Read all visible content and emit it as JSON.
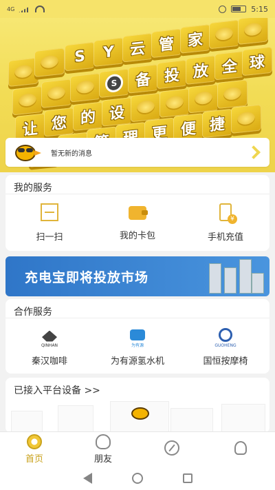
{
  "status": {
    "signal": "4G",
    "time": "5:15"
  },
  "hero": {
    "row1_chars": [
      "S",
      "Y",
      "云",
      "管",
      "家"
    ],
    "row2_chars": [
      "备",
      "投",
      "放",
      "全",
      "球"
    ],
    "row3_chars": [
      "让",
      "您",
      "的",
      "设"
    ],
    "row4_chars": [
      "管",
      "理",
      "更",
      "便",
      "捷"
    ]
  },
  "notice": {
    "text": "暂无新的消息"
  },
  "services": {
    "title": "我的服务",
    "items": [
      {
        "label": "扫一扫",
        "icon": "scan-icon"
      },
      {
        "label": "我的卡包",
        "icon": "wallet-icon"
      },
      {
        "label": "手机充值",
        "icon": "phone-recharge-icon"
      }
    ]
  },
  "banner": {
    "text": "充电宝即将投放市场"
  },
  "partners": {
    "title": "合作服务",
    "items": [
      {
        "label": "秦汉咖啡",
        "logo_text": "QINHAN"
      },
      {
        "label": "为有源氢水机",
        "logo_text": "为有源"
      },
      {
        "label": "国恒按摩椅",
        "logo_text": "GUOHENG"
      }
    ]
  },
  "devices": {
    "title": "已接入平台设备 >>"
  },
  "tabbar": {
    "items": [
      {
        "label": "首页",
        "active": true
      },
      {
        "label": "朋友",
        "active": false
      },
      {
        "label": "",
        "active": false
      },
      {
        "label": "",
        "active": false
      }
    ]
  },
  "colors": {
    "accent": "#c9a21b",
    "hero_bg": "#f2dc55",
    "banner": "#2f76c8"
  }
}
